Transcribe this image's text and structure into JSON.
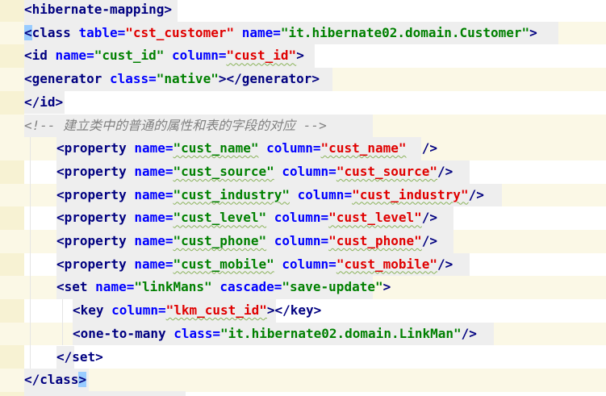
{
  "editor": {
    "lines": [
      {
        "segments": [
          {
            "cls": "t",
            "text": "<hibernate-mapping>"
          }
        ]
      },
      {
        "segments": [
          {
            "cls": "t brace",
            "text": "<"
          },
          {
            "cls": "t",
            "text": "class "
          },
          {
            "cls": "a",
            "text": "table="
          },
          {
            "cls": "r",
            "text": "\"cst_customer\""
          },
          {
            "cls": "t",
            "text": " "
          },
          {
            "cls": "a",
            "text": "name="
          },
          {
            "cls": "v",
            "text": "\"it.hibernate02.domain.Customer\""
          },
          {
            "cls": "t",
            "text": ">"
          }
        ]
      },
      {
        "segments": [
          {
            "cls": "t",
            "text": "<id "
          },
          {
            "cls": "a",
            "text": "name="
          },
          {
            "cls": "v",
            "text": "\"cust_id\""
          },
          {
            "cls": "t",
            "text": " "
          },
          {
            "cls": "a",
            "text": "column="
          },
          {
            "cls": "r squig",
            "text": "\"cust_id\""
          },
          {
            "cls": "t",
            "text": ">"
          }
        ]
      },
      {
        "segments": [
          {
            "cls": "t",
            "text": "<generator "
          },
          {
            "cls": "a",
            "text": "class="
          },
          {
            "cls": "v",
            "text": "\"native\""
          },
          {
            "cls": "t",
            "text": "></generator>"
          }
        ]
      },
      {
        "segments": [
          {
            "cls": "t",
            "text": "</id>"
          }
        ]
      },
      {
        "segments": [
          {
            "cls": "c",
            "text": "<!-- 建立类中的普通的属性和表的字段的对应 -->"
          }
        ]
      },
      {
        "segments": [
          {
            "cls": "t",
            "text": "<property "
          },
          {
            "cls": "a",
            "text": "name="
          },
          {
            "cls": "v squig",
            "text": "\"cust_name\""
          },
          {
            "cls": "t",
            "text": " "
          },
          {
            "cls": "a",
            "text": "column="
          },
          {
            "cls": "r squig",
            "text": "\"cust_name\""
          },
          {
            "cls": "t",
            "text": "  />"
          }
        ]
      },
      {
        "segments": [
          {
            "cls": "t",
            "text": "<property "
          },
          {
            "cls": "a",
            "text": "name="
          },
          {
            "cls": "v squig",
            "text": "\"cust_source\""
          },
          {
            "cls": "t",
            "text": " "
          },
          {
            "cls": "a",
            "text": "column="
          },
          {
            "cls": "r squig",
            "text": "\"cust_source\""
          },
          {
            "cls": "t",
            "text": "/>"
          }
        ]
      },
      {
        "segments": [
          {
            "cls": "t",
            "text": "<property "
          },
          {
            "cls": "a",
            "text": "name="
          },
          {
            "cls": "v squig",
            "text": "\"cust_industry\""
          },
          {
            "cls": "t",
            "text": " "
          },
          {
            "cls": "a",
            "text": "column="
          },
          {
            "cls": "r squig",
            "text": "\"cust_industry\""
          },
          {
            "cls": "t",
            "text": "/>"
          }
        ]
      },
      {
        "segments": [
          {
            "cls": "t",
            "text": "<property "
          },
          {
            "cls": "a",
            "text": "name="
          },
          {
            "cls": "v squig",
            "text": "\"cust_level\""
          },
          {
            "cls": "t",
            "text": " "
          },
          {
            "cls": "a",
            "text": "column="
          },
          {
            "cls": "r squig",
            "text": "\"cust_level\""
          },
          {
            "cls": "t",
            "text": "/>"
          }
        ]
      },
      {
        "segments": [
          {
            "cls": "t",
            "text": "<property "
          },
          {
            "cls": "a",
            "text": "name="
          },
          {
            "cls": "v squig",
            "text": "\"cust_phone\""
          },
          {
            "cls": "t",
            "text": " "
          },
          {
            "cls": "a",
            "text": "column="
          },
          {
            "cls": "r squig",
            "text": "\"cust_phone\""
          },
          {
            "cls": "t",
            "text": "/>"
          }
        ]
      },
      {
        "segments": [
          {
            "cls": "t",
            "text": "<property "
          },
          {
            "cls": "a",
            "text": "name="
          },
          {
            "cls": "v squig",
            "text": "\"cust_mobile\""
          },
          {
            "cls": "t",
            "text": " "
          },
          {
            "cls": "a",
            "text": "column="
          },
          {
            "cls": "r squig",
            "text": "\"cust_mobile\""
          },
          {
            "cls": "t",
            "text": "/>"
          }
        ]
      },
      {
        "segments": [
          {
            "cls": "t",
            "text": "<set "
          },
          {
            "cls": "a",
            "text": "name="
          },
          {
            "cls": "v",
            "text": "\"linkMans\""
          },
          {
            "cls": "t",
            "text": " "
          },
          {
            "cls": "a",
            "text": "cascade="
          },
          {
            "cls": "v",
            "text": "\"save-update\""
          },
          {
            "cls": "t",
            "text": ">"
          }
        ]
      },
      {
        "segments": [
          {
            "cls": "t",
            "text": "<key "
          },
          {
            "cls": "a",
            "text": "column="
          },
          {
            "cls": "r squig",
            "text": "\"lkm_cust_id\""
          },
          {
            "cls": "t",
            "text": "></key>"
          }
        ]
      },
      {
        "segments": [
          {
            "cls": "t",
            "text": "<one-to-many "
          },
          {
            "cls": "a",
            "text": "class="
          },
          {
            "cls": "v",
            "text": "\"it.hibernate02.domain.LinkMan\""
          },
          {
            "cls": "t",
            "text": "/>"
          }
        ]
      },
      {
        "segments": [
          {
            "cls": "t",
            "text": "</set>"
          }
        ]
      },
      {
        "segments": [
          {
            "cls": "t",
            "text": "</class"
          },
          {
            "cls": "t brace",
            "text": ">"
          }
        ]
      }
    ]
  },
  "colors": {
    "tag": "#000080",
    "attribute": "#0000ff",
    "value": "#008000",
    "column_value": "#e00000",
    "comment": "#808080",
    "brace_match": "#99ccff",
    "line_tint": "#fbf8e6",
    "code_bg": "#eeeeee"
  }
}
